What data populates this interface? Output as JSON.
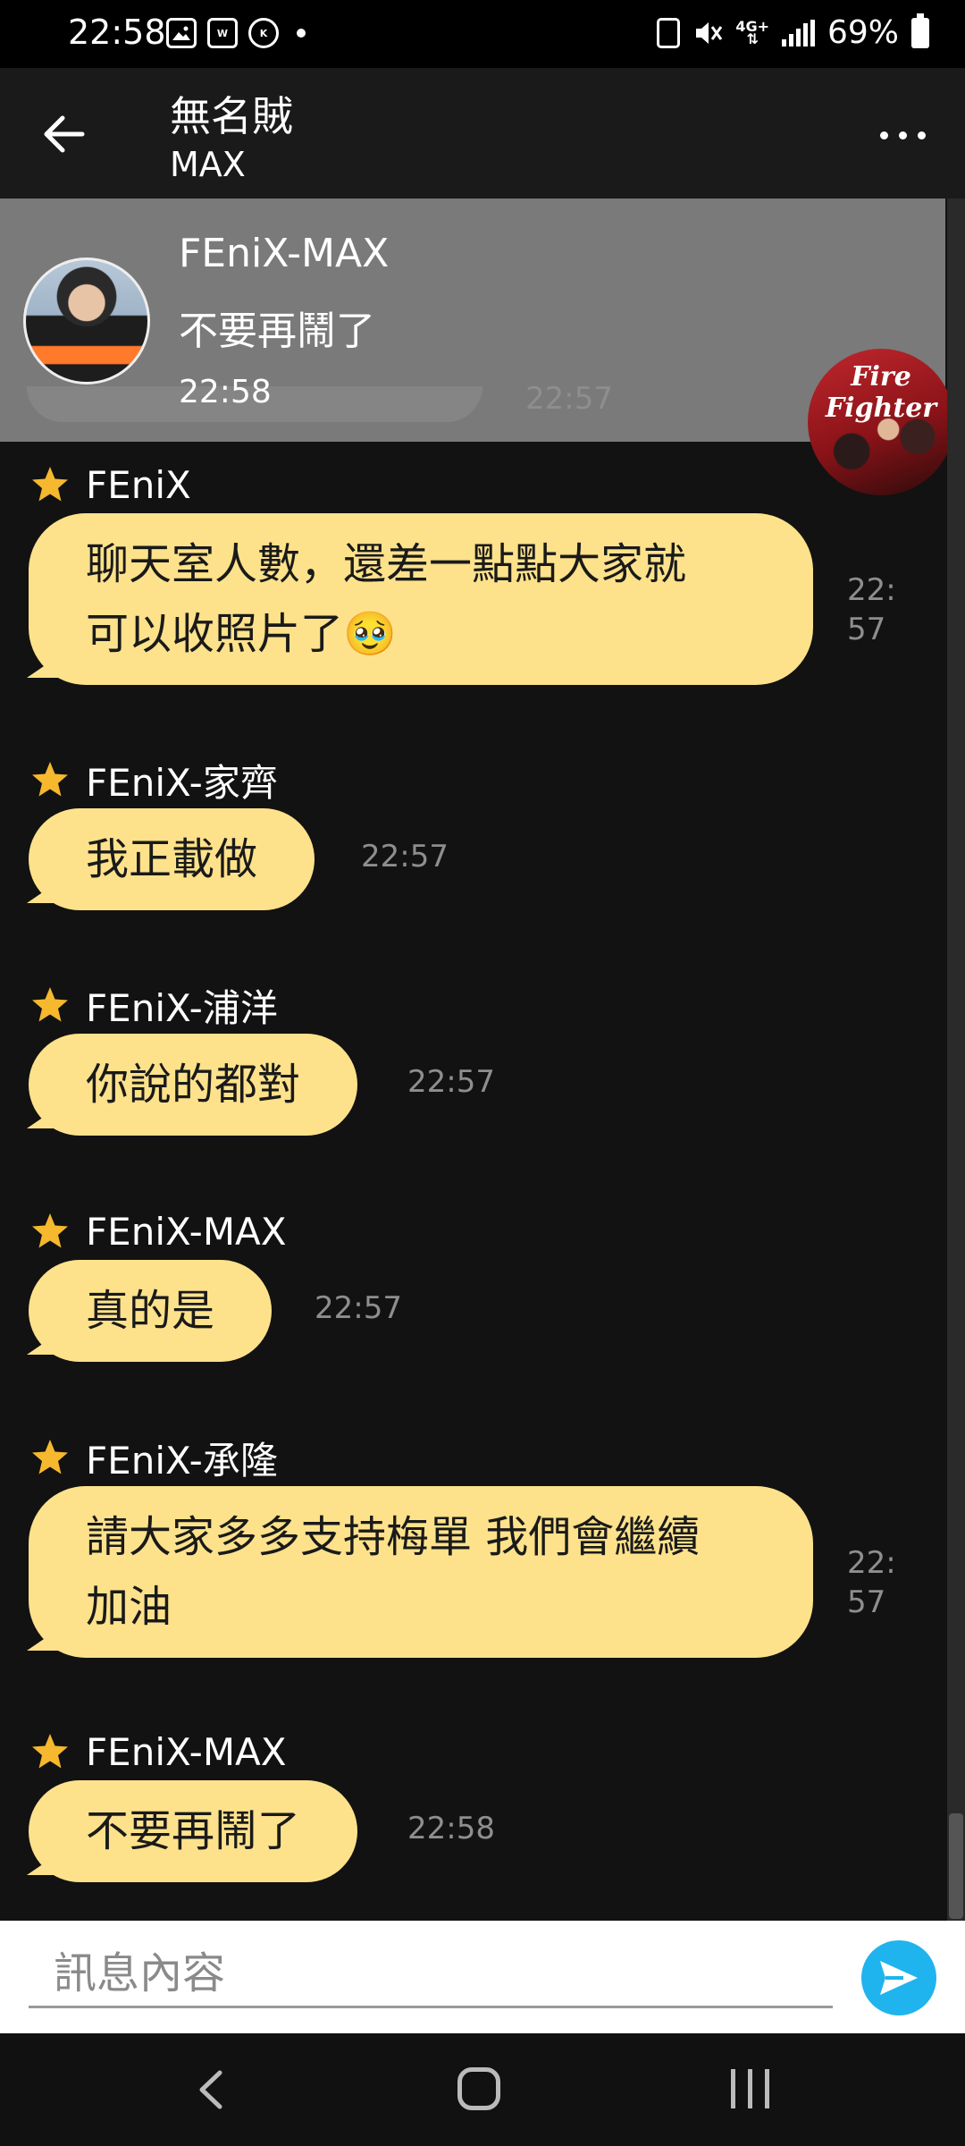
{
  "status_bar": {
    "time": "22:58",
    "icons": [
      "gallery-icon",
      "webtoon-icon",
      "k-app-icon",
      "notification-dot-icon"
    ],
    "right_icons": [
      "battery-saver-icon",
      "mute-icon",
      "4g-signal-icon"
    ],
    "network_label": "4G+",
    "battery": "69%"
  },
  "header": {
    "title": "無名賊",
    "subtitle": "MAX"
  },
  "pinned": {
    "name": "FEniX-MAX",
    "message": "不要再鬧了",
    "time": "22:58",
    "ghost_time": "22:57"
  },
  "float_avatar": {
    "caption": "Fire Fighter"
  },
  "messages": [
    {
      "sender": "FEniX",
      "lines": [
        "聊天室人數，還差一點點大家就",
        "可以收照片了🥹"
      ],
      "time_lines": [
        "22:",
        "57"
      ]
    },
    {
      "sender": "FEniX-家齊",
      "lines": [
        "我正載做"
      ],
      "time_lines": [
        "22:57"
      ]
    },
    {
      "sender": "FEniX-浦洋",
      "lines": [
        "你說的都對"
      ],
      "time_lines": [
        "22:57"
      ]
    },
    {
      "sender": "FEniX-MAX",
      "lines": [
        "真的是"
      ],
      "time_lines": [
        "22:57"
      ]
    },
    {
      "sender": "FEniX-承隆",
      "lines": [
        "請大家多多支持梅單 我們會繼續",
        "加油"
      ],
      "time_lines": [
        "22:",
        "57"
      ]
    },
    {
      "sender": "FEniX-MAX",
      "lines": [
        "不要再鬧了"
      ],
      "time_lines": [
        "22:58"
      ]
    }
  ],
  "input": {
    "placeholder": "訊息內容"
  },
  "colors": {
    "bubble": "#fde28b",
    "chat_bg": "#121212",
    "send_button": "#1fb4ee",
    "star": "#f5b82e"
  }
}
